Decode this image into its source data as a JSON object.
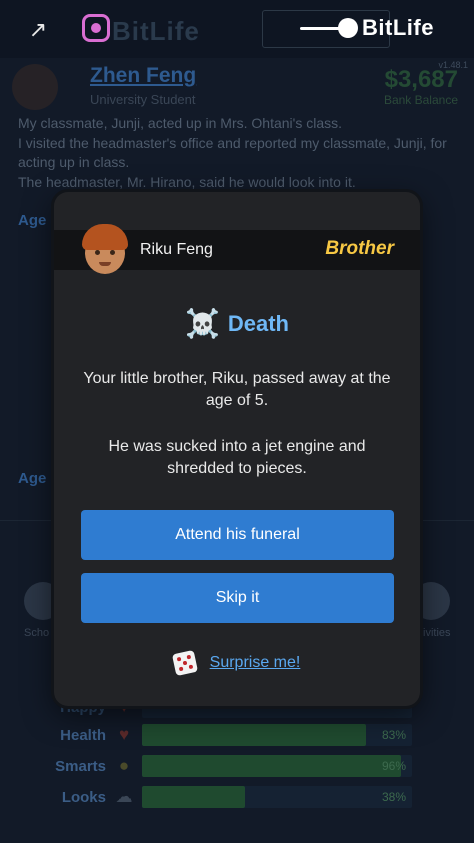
{
  "app": {
    "brand": "BitLife",
    "version": "v1.48.1",
    "share_icon": "share-icon",
    "instagram_icon": "instagram-icon"
  },
  "background": {
    "character_name": "Zhen Feng",
    "character_status": "University Student",
    "bank_balance": "$3,687",
    "bank_balance_label": "Bank Balance",
    "log_lines": [
      "My classmate, Junji, acted up in Mrs. Ohtani's class.",
      "I visited the headmaster's office and reported my classmate, Junji, for acting up in class.",
      "The headmaster, Mr. Hirano, said he would look into it."
    ],
    "age_heading_1": "Age",
    "age_heading_2": "Age",
    "left_label": "Scho",
    "right_label": "ivities",
    "stats": [
      {
        "name": "Happy",
        "icon": "heart-icon",
        "percent_text": "",
        "value": 0
      },
      {
        "name": "Health",
        "icon": "heart-icon",
        "percent_text": "83%",
        "value": 83
      },
      {
        "name": "Smarts",
        "icon": "lightbulb-icon",
        "percent_text": "96%",
        "value": 96
      },
      {
        "name": "Looks",
        "icon": "cloud-icon",
        "percent_text": "38%",
        "value": 38
      }
    ]
  },
  "modal": {
    "person_name": "Riku Feng",
    "relationship": "Brother",
    "event_icon": "☠️",
    "event_title": "Death",
    "message_1": "Your little brother, Riku, passed away at the age of 5.",
    "message_2": "He was sucked into a jet engine and shredded to pieces.",
    "button_attend": "Attend his funeral",
    "button_skip": "Skip it",
    "surprise_label": "Surprise me!"
  },
  "colors": {
    "accent_blue": "#2f7cd1",
    "relationship_gold": "#f7c844",
    "title_blue": "#6fb8f6",
    "modal_bg": "#222326"
  }
}
